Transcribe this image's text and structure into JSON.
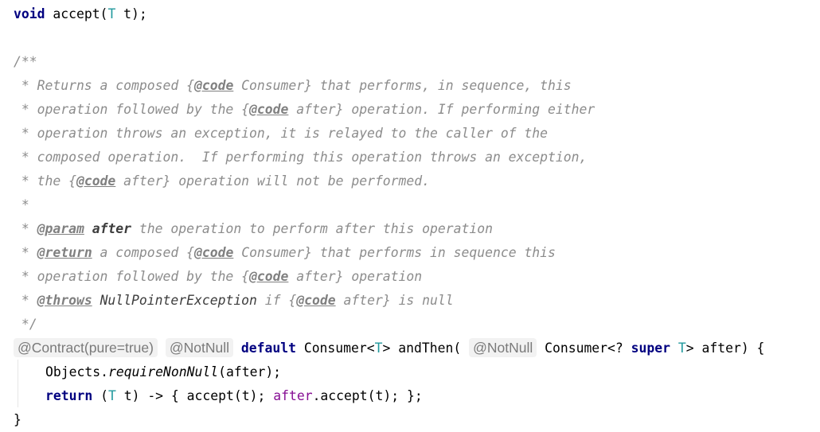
{
  "line1": {
    "ret": "void",
    "name": " accept(",
    "tparam": "T",
    "rest": " t);"
  },
  "doc": {
    "open": "/**",
    "l1": {
      "a": " * Returns a composed {",
      "tag": "@code",
      "b": " Consumer} that performs, in sequence, this"
    },
    "l2": {
      "a": " * operation followed by the {",
      "tag": "@code",
      "b": " after} operation. If performing either"
    },
    "l3": " * operation throws an exception, it is relayed to the caller of the",
    "l4": " * composed operation.  If performing this operation throws an exception,",
    "l5": {
      "a": " * the {",
      "tag": "@code",
      "b": " after} operation will not be performed."
    },
    "l6": " *",
    "l7": {
      "a": " * ",
      "tag": "@param",
      "sp": " ",
      "value": "after",
      "b": " the operation to perform after this operation"
    },
    "l8": {
      "a": " * ",
      "tag": "@return",
      "b": " a composed {",
      "tag2": "@code",
      "c": " Consumer} that performs in sequence this"
    },
    "l9": {
      "a": " * operation followed by the {",
      "tag": "@code",
      "b": " after} operation"
    },
    "l10": {
      "a": " * ",
      "tag": "@throws",
      "sp": " ",
      "value": "NullPointerException",
      "b": " if {",
      "tag2": "@code",
      "c": " after} is null"
    },
    "close": " */"
  },
  "sig": {
    "ann1": "@Contract(pure=true)",
    "ann2": "@NotNull",
    "kw_default": "default",
    "t1": " Consumer<",
    "tp1": "T",
    "t2": "> andThen( ",
    "ann3": "@NotNull",
    "t3": " Consumer<? ",
    "kw_super": "super",
    "sp": " ",
    "tp2": "T",
    "t4": "> after) {"
  },
  "body1": {
    "a": "Objects.",
    "method": "requireNonNull",
    "b": "(after);"
  },
  "body2": {
    "kw": "return",
    "a": " (",
    "tp": "T",
    "b": " t) -> { accept(t); ",
    "field": "after",
    "c": ".accept(t); };"
  },
  "closing": "}"
}
